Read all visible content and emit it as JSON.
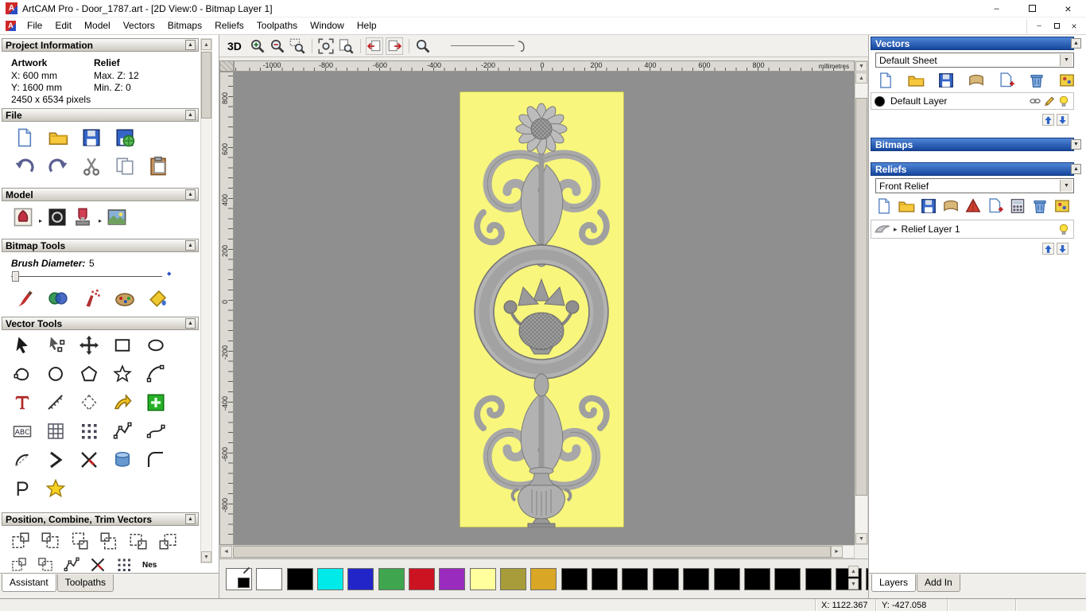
{
  "window": {
    "title": "ArtCAM Pro - Door_1787.art - [2D View:0 - Bitmap Layer 1]",
    "controls": {
      "minimize": "–",
      "close": "×"
    }
  },
  "menu": {
    "items": [
      "File",
      "Edit",
      "Model",
      "Vectors",
      "Bitmaps",
      "Reliefs",
      "Toolpaths",
      "Window",
      "Help"
    ]
  },
  "icons": {
    "collapse_up": "▲",
    "collapse_down": "▼",
    "scroll_up": "▲",
    "scroll_down": "▼",
    "scroll_left": "◄",
    "scroll_right": "►",
    "dropdown_arrow": "▼",
    "flyout_arrow": "▸",
    "expand_arrow": "▸",
    "slider_dot": "◆"
  },
  "left_panel": {
    "project_information": {
      "title": "Project Information",
      "artwork_label": "Artwork",
      "relief_label": "Relief",
      "x": "X: 600 mm",
      "y": "Y: 1600 mm",
      "max_z": "Max. Z: 12",
      "min_z": "Min. Z: 0",
      "pixels": "2450 x 6534 pixels"
    },
    "file_section": {
      "title": "File",
      "toolbar_icons": [
        "new-model",
        "open-model",
        "save-model",
        "import-model",
        "undo",
        "redo",
        "cut",
        "copy",
        "paste"
      ]
    },
    "model_section": {
      "title": "Model",
      "toolbar_icons": [
        "add-relief",
        "greyscale-model",
        "stamp-relief",
        "load-image"
      ]
    },
    "bitmap_tools": {
      "title": "Bitmap Tools",
      "brush_label": "Brush Diameter:",
      "brush_value": "5",
      "toolbar_icons": [
        "paint-brush",
        "paint-selective",
        "airbrush",
        "colour-palette",
        "flood-fill"
      ]
    },
    "vector_tools": {
      "title": "Vector Tools",
      "tools": [
        "select",
        "node-edit",
        "transform",
        "create-rectangle",
        "create-ellipse",
        "create-freeform",
        "create-circle",
        "create-polygon",
        "create-star",
        "create-arc",
        "create-text",
        "measure",
        "create-diamond",
        "offset-vector",
        "paste-special",
        "text-block",
        "grid",
        "point-cloud",
        "polyline",
        "fit-curve",
        "arc-segment",
        "chevron",
        "trim-cross",
        "extrude",
        "fillet",
        "profile",
        "star-wizard"
      ]
    },
    "position_section": {
      "title": "Position, Combine, Trim Vectors",
      "tools_row1": [
        "align-left",
        "align-right",
        "align-top",
        "align-bottom",
        "align-centre",
        "mirror-vectors"
      ],
      "tools_row2": [
        "group-vectors",
        "ungroup-vectors",
        "join-vectors",
        "trim-vectors",
        "weld-vectors",
        "nest-vectors"
      ],
      "nes_label": "Nes"
    },
    "tabs": [
      {
        "label": "Assistant",
        "active": true
      },
      {
        "label": "Toolpaths",
        "active": false
      }
    ]
  },
  "canvas": {
    "toolbar": {
      "view_3d": "3D",
      "icons": [
        "zoom-in",
        "zoom-out",
        "zoom-window",
        "zoom-fit",
        "zoom-sheet",
        "previous-view",
        "next-view",
        "zoom-selection"
      ]
    },
    "h_ruler": {
      "ticks": [
        "-1000",
        "-800",
        "-600",
        "-400",
        "-200",
        "0",
        "200",
        "400",
        "600",
        "800"
      ],
      "units": "millimetres"
    },
    "v_ruler": {
      "ticks": [
        "800",
        "600",
        "400",
        "200",
        "0",
        "-200",
        "-400",
        "-600",
        "-800"
      ]
    },
    "artwork": {
      "canvas_color": "#f8f67c",
      "relief_color": "#b0b0b0"
    }
  },
  "right_panel": {
    "vectors": {
      "title": "Vectors",
      "sheet_selector": "Default Sheet",
      "toolbar_icons": [
        "new",
        "open",
        "save",
        "merge",
        "new-layer",
        "delete-layer",
        "layer-colour"
      ],
      "layer": {
        "name": "Default Layer",
        "color": "#000000",
        "icons": [
          "lock",
          "edit",
          "visibility"
        ]
      }
    },
    "bitmaps": {
      "title": "Bitmaps"
    },
    "reliefs": {
      "title": "Reliefs",
      "relief_selector": "Front Relief",
      "toolbar_icons": [
        "new",
        "open",
        "save",
        "merge",
        "add-shape",
        "new-layer",
        "calculate",
        "delete-layer",
        "layer-colour"
      ],
      "layer": {
        "name": "Relief Layer 1",
        "icons": [
          "visibility"
        ]
      }
    },
    "tabs": [
      {
        "label": "Layers",
        "active": true
      },
      {
        "label": "Add In",
        "active": false
      }
    ]
  },
  "palette": {
    "colors": [
      "#ffffff",
      "#000000",
      "#00eaea",
      "#2226c8",
      "#3fa54e",
      "#cc1322",
      "#9a2bbf",
      "#ffff9e",
      "#a89c3a",
      "#d9a625",
      "#000000",
      "#000000",
      "#000000",
      "#000000",
      "#000000",
      "#000000",
      "#000000",
      "#000000",
      "#000000",
      "#000000",
      "#000000"
    ]
  },
  "status_bar": {
    "x": "X: 1122.367",
    "y": "Y: -427.058"
  }
}
